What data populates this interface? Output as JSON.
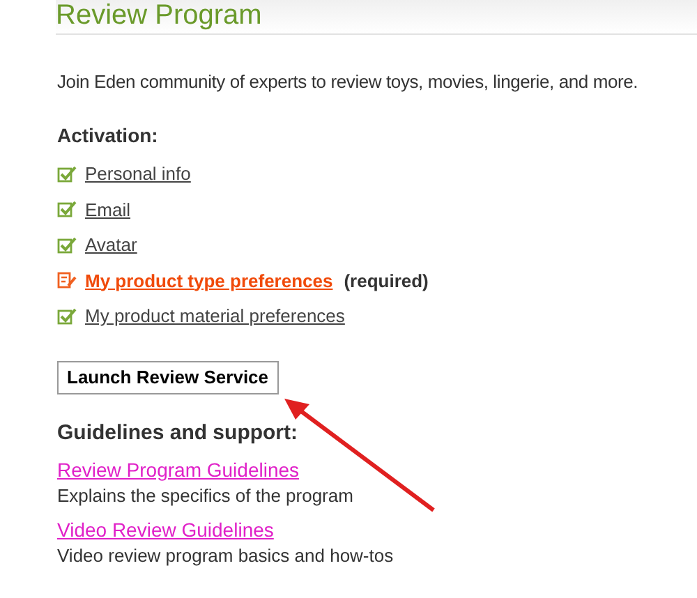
{
  "header": {
    "title": "Review Program"
  },
  "intro": "Join Eden community of experts to review toys, movies, lingerie, and more.",
  "activation": {
    "heading": "Activation:",
    "items": [
      {
        "label": "Personal info",
        "checked": true
      },
      {
        "label": "Email",
        "checked": true
      },
      {
        "label": "Avatar",
        "checked": true
      },
      {
        "label": "My product type preferences",
        "checked": false,
        "note": "(required)"
      },
      {
        "label": "My product material preferences",
        "checked": true
      }
    ]
  },
  "launch_button": "Launch Review Service",
  "guidelines": {
    "heading": "Guidelines and support:",
    "items": [
      {
        "link": "Review Program Guidelines",
        "description": "Explains the specifics of the program"
      },
      {
        "link": "Video Review Guidelines",
        "description": "Video review program basics and how-tos"
      }
    ]
  }
}
